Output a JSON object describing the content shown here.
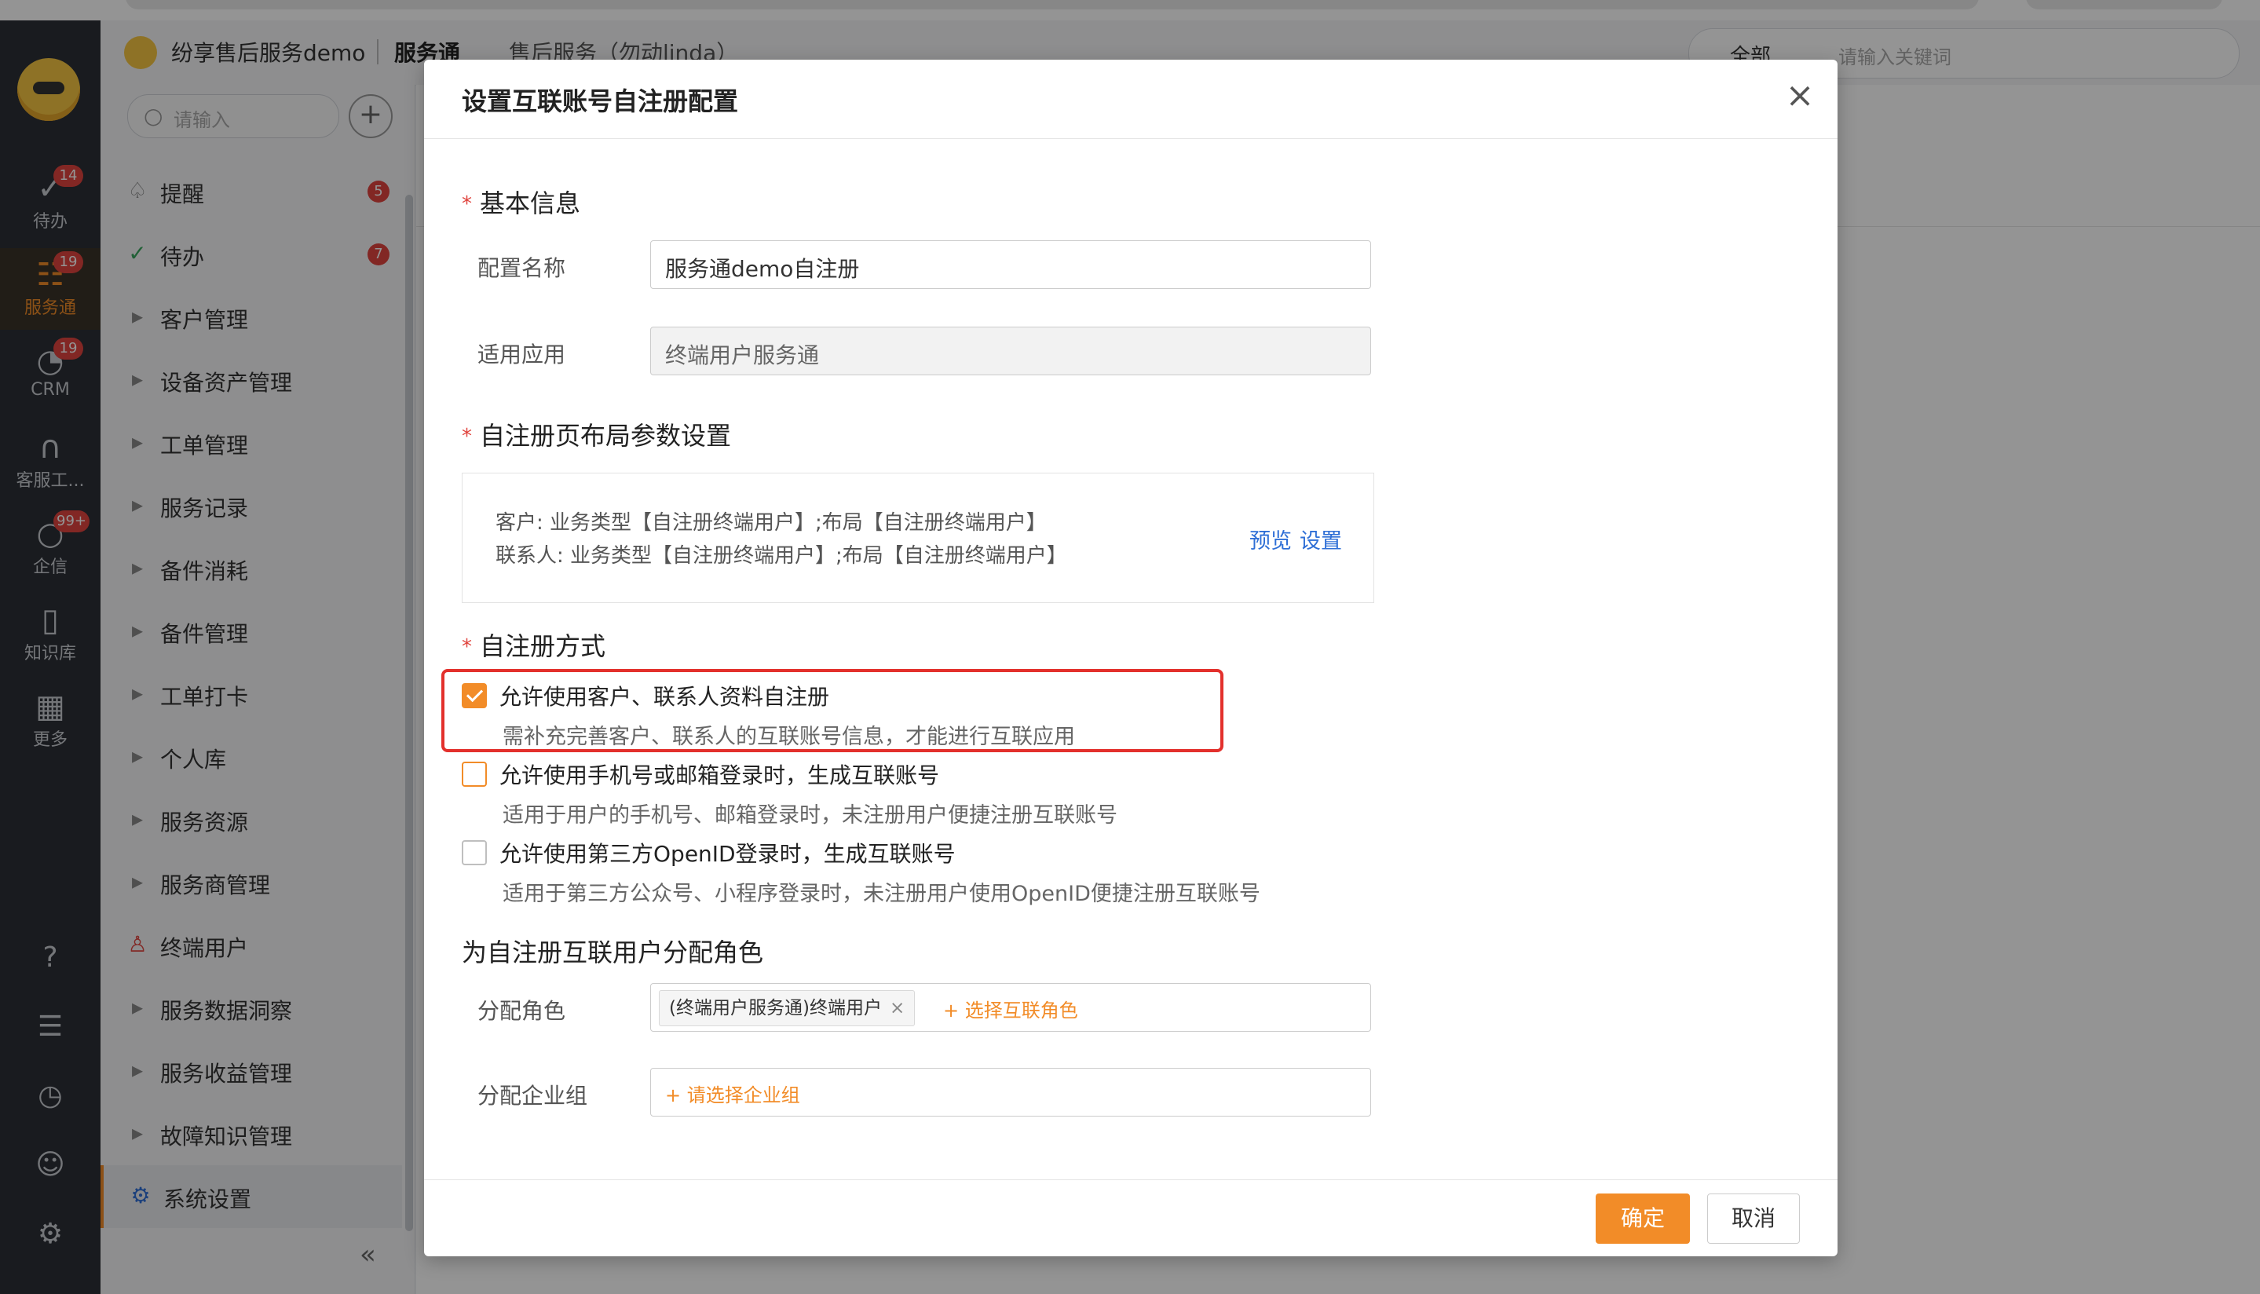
{
  "app": {
    "tenant_name": "纷享售后服务demo",
    "module_name": "服务通",
    "workspace": "售后服务（勿动linda）",
    "search_scope": "全部",
    "search_placeholder": "请输入关键词"
  },
  "rail": {
    "items": [
      {
        "label": "待办",
        "badge": "14",
        "icon": "check-circle-icon"
      },
      {
        "label": "服务通",
        "badge": "19",
        "icon": "service-icon"
      },
      {
        "label": "CRM",
        "badge": "19",
        "icon": "pie-chart-icon"
      },
      {
        "label": "客服工...",
        "badge": "",
        "icon": "headset-icon"
      },
      {
        "label": "企信",
        "badge": "99+",
        "icon": "chat-bubble-icon"
      },
      {
        "label": "知识库",
        "badge": "",
        "icon": "book-icon"
      },
      {
        "label": "更多",
        "badge": "",
        "icon": "grid-icon"
      }
    ]
  },
  "menu": {
    "search_placeholder": "请输入",
    "items": [
      {
        "label": "提醒",
        "badge": "5",
        "icon": "bell-icon"
      },
      {
        "label": "待办",
        "badge": "7",
        "icon": "check-circle-icon"
      },
      {
        "label": "客户管理",
        "icon": "caret-right-icon"
      },
      {
        "label": "设备资产管理",
        "icon": "caret-right-icon"
      },
      {
        "label": "工单管理",
        "icon": "caret-right-icon"
      },
      {
        "label": "服务记录",
        "icon": "caret-right-icon"
      },
      {
        "label": "备件消耗",
        "icon": "caret-right-icon"
      },
      {
        "label": "备件管理",
        "icon": "caret-right-icon"
      },
      {
        "label": "工单打卡",
        "icon": "caret-right-icon"
      },
      {
        "label": "个人库",
        "icon": "caret-right-icon"
      },
      {
        "label": "服务资源",
        "icon": "caret-right-icon"
      },
      {
        "label": "服务商管理",
        "icon": "caret-right-icon"
      },
      {
        "label": "终端用户",
        "icon": "user-icon"
      },
      {
        "label": "服务数据洞察",
        "icon": "caret-right-icon"
      },
      {
        "label": "服务收益管理",
        "icon": "caret-right-icon"
      },
      {
        "label": "故障知识管理",
        "icon": "caret-right-icon"
      },
      {
        "label": "系统设置",
        "icon": "gear-icon",
        "active": true
      }
    ]
  },
  "dialog": {
    "title": "设置互联账号自注册配置",
    "basic_section": "基本信息",
    "config_name_label": "配置名称",
    "config_name_value": "服务通demo自注册",
    "app_label": "适用应用",
    "app_value": "终端用户服务通",
    "layout_section": "自注册页布局参数设置",
    "layout_line1": "客户: 业务类型【自注册终端用户】;布局【自注册终端用户】",
    "layout_line2": "联系人: 业务类型【自注册终端用户】;布局【自注册终端用户】",
    "preview_link": "预览",
    "settings_link": "设置",
    "method_section": "自注册方式",
    "options": [
      {
        "label": "允许使用客户、联系人资料自注册",
        "desc": "需补充完善客户、联系人的互联账号信息，才能进行互联应用",
        "checked": true
      },
      {
        "label": "允许使用手机号或邮箱登录时，生成互联账号",
        "desc": "适用于用户的手机号、邮箱登录时，未注册用户便捷注册互联账号",
        "checked": false
      },
      {
        "label": "允许使用第三方OpenID登录时，生成互联账号",
        "desc": "适用于第三方公众号、小程序登录时，未注册用户使用OpenID便捷注册互联账号",
        "checked": false
      }
    ],
    "role_section": "为自注册互联用户分配角色",
    "role_label": "分配角色",
    "role_tag": "(终端用户服务通)终端用户",
    "role_add": "+ 选择互联角色",
    "group_label": "分配企业组",
    "group_add": "+ 请选择企业组",
    "ok_button": "确定",
    "cancel_button": "取消"
  },
  "colors": {
    "accent": "#f28c28",
    "rail_bg": "#2b2f36",
    "highlight": "#e3302c",
    "link": "#2f6fd6"
  }
}
